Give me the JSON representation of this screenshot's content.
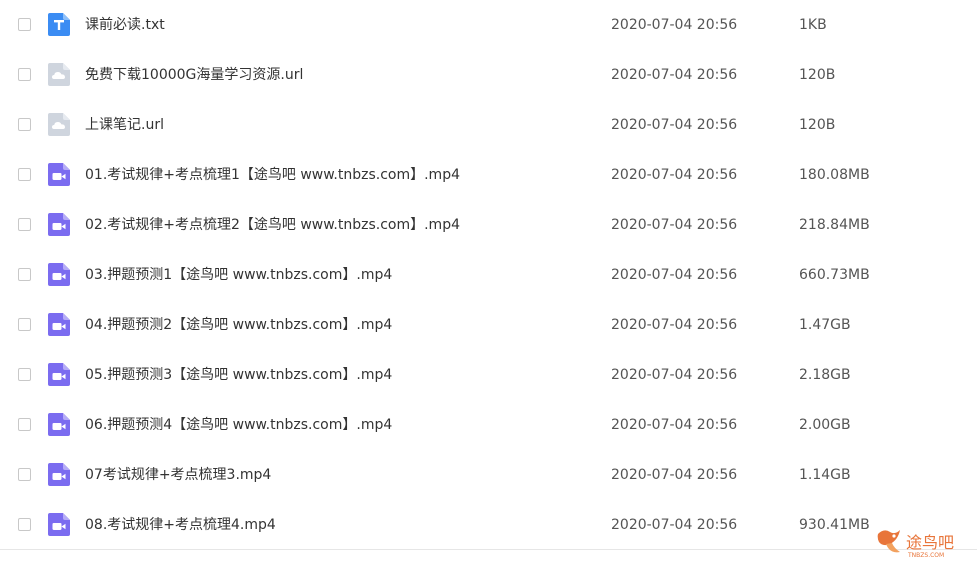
{
  "files": [
    {
      "name": "课前必读.txt",
      "date": "2020-07-04 20:56",
      "size": "1KB",
      "type": "txt",
      "icon": "text-file-icon"
    },
    {
      "name": "免费下载10000G海量学习资源.url",
      "date": "2020-07-04 20:56",
      "size": "120B",
      "type": "url",
      "icon": "link-file-icon"
    },
    {
      "name": "上课笔记.url",
      "date": "2020-07-04 20:56",
      "size": "120B",
      "type": "url",
      "icon": "link-file-icon"
    },
    {
      "name": "01.考试规律+考点梳理1【途鸟吧 www.tnbzs.com】.mp4",
      "date": "2020-07-04 20:56",
      "size": "180.08MB",
      "type": "video",
      "icon": "video-file-icon"
    },
    {
      "name": "02.考试规律+考点梳理2【途鸟吧 www.tnbzs.com】.mp4",
      "date": "2020-07-04 20:56",
      "size": "218.84MB",
      "type": "video",
      "icon": "video-file-icon"
    },
    {
      "name": "03.押题预测1【途鸟吧 www.tnbzs.com】.mp4",
      "date": "2020-07-04 20:56",
      "size": "660.73MB",
      "type": "video",
      "icon": "video-file-icon"
    },
    {
      "name": "04.押题预测2【途鸟吧 www.tnbzs.com】.mp4",
      "date": "2020-07-04 20:56",
      "size": "1.47GB",
      "type": "video",
      "icon": "video-file-icon"
    },
    {
      "name": "05.押题预测3【途鸟吧 www.tnbzs.com】.mp4",
      "date": "2020-07-04 20:56",
      "size": "2.18GB",
      "type": "video",
      "icon": "video-file-icon"
    },
    {
      "name": "06.押题预测4【途鸟吧 www.tnbzs.com】.mp4",
      "date": "2020-07-04 20:56",
      "size": "2.00GB",
      "type": "video",
      "icon": "video-file-icon"
    },
    {
      "name": "07考试规律+考点梳理3.mp4",
      "date": "2020-07-04 20:56",
      "size": "1.14GB",
      "type": "video",
      "icon": "video-file-icon"
    },
    {
      "name": "08.考试规律+考点梳理4.mp4",
      "date": "2020-07-04 20:56",
      "size": "930.41MB",
      "type": "video",
      "icon": "video-file-icon"
    }
  ],
  "watermark": {
    "text": "途鸟吧",
    "url_text": "TNBZS.COM"
  },
  "colors": {
    "txt_icon": "#3b8cf3",
    "url_icon": "#cfd5de",
    "video_icon": "#7b6cf0",
    "watermark": "#e8753a"
  }
}
